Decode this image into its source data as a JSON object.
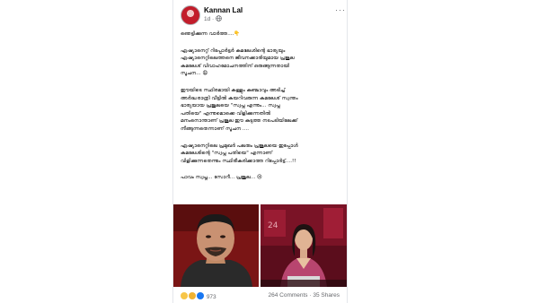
{
  "post": {
    "author": "Kannan Lal",
    "timestamp": "1d",
    "privacy_icon": "globe-icon",
    "more_label": "···",
    "paragraphs": [
      "ഞെട്ടിക്കുന്ന വാർത്ത....👇",
      "ഏഷ്യാനെറ്റ് റിപ്പോർട്ടർ കമലേശിന്റെ ഭാര്യയും\nഏഷ്യാനെറ്റിലെത്തനെ ജീവനക്കാരിയുമായ പ്രജുല\nകമലേശ്  വിവാഹമോചനത്തിന് ഒരുങ്ങുന്നതായി\nസൂചന... 😩",
      "ഈയിടെ സ്ഥിരമായി കള്ളും കഞ്ചാവും അടിച്ച്\nഅർദ്ധരാത്രി വീട്ടിൽ കയറിവരുന്ന കമലേശ് സ്വന്തം\nഭാര്യയായ പ്രജുലയെ \"സ്വപ്ന എന്നും... സ്വപ്ന\nപതിയെ\" എന്നുമൊക്കെ വിളിക്കുന്നതിൽ\nമനംനൊന്താണ് പ്രജുല ഈ കടുത്ത നടപടിയിലേക്ക്\nനീങ്ങുന്നതെന്നാണ് സൂചന ....",
      "ഏഷ്യാനെറ്റിലെ പ്രമുഖർ പലരും പ്രജുലയെ ഇപ്പോൾ\nകമലേശിന്റെ \"സ്വപ്ന പതിയെ\" എന്നാണ്\nവിളിക്കുന്നതെന്നും സ്ഥിരീകരിക്കാത്ത റിപ്പോർട്ട്....!!",
      "പാവം സ്വപ്ന... സോറീ... പ്രജുല... 😢"
    ],
    "photos": [
      "portrait-photo",
      "news-anchor-photo"
    ],
    "reactions_count": "973",
    "comments": "264 Comments",
    "shares": "35 Shares",
    "separator": "·",
    "colors": {
      "meta": "#65676b",
      "text": "#050505"
    }
  }
}
